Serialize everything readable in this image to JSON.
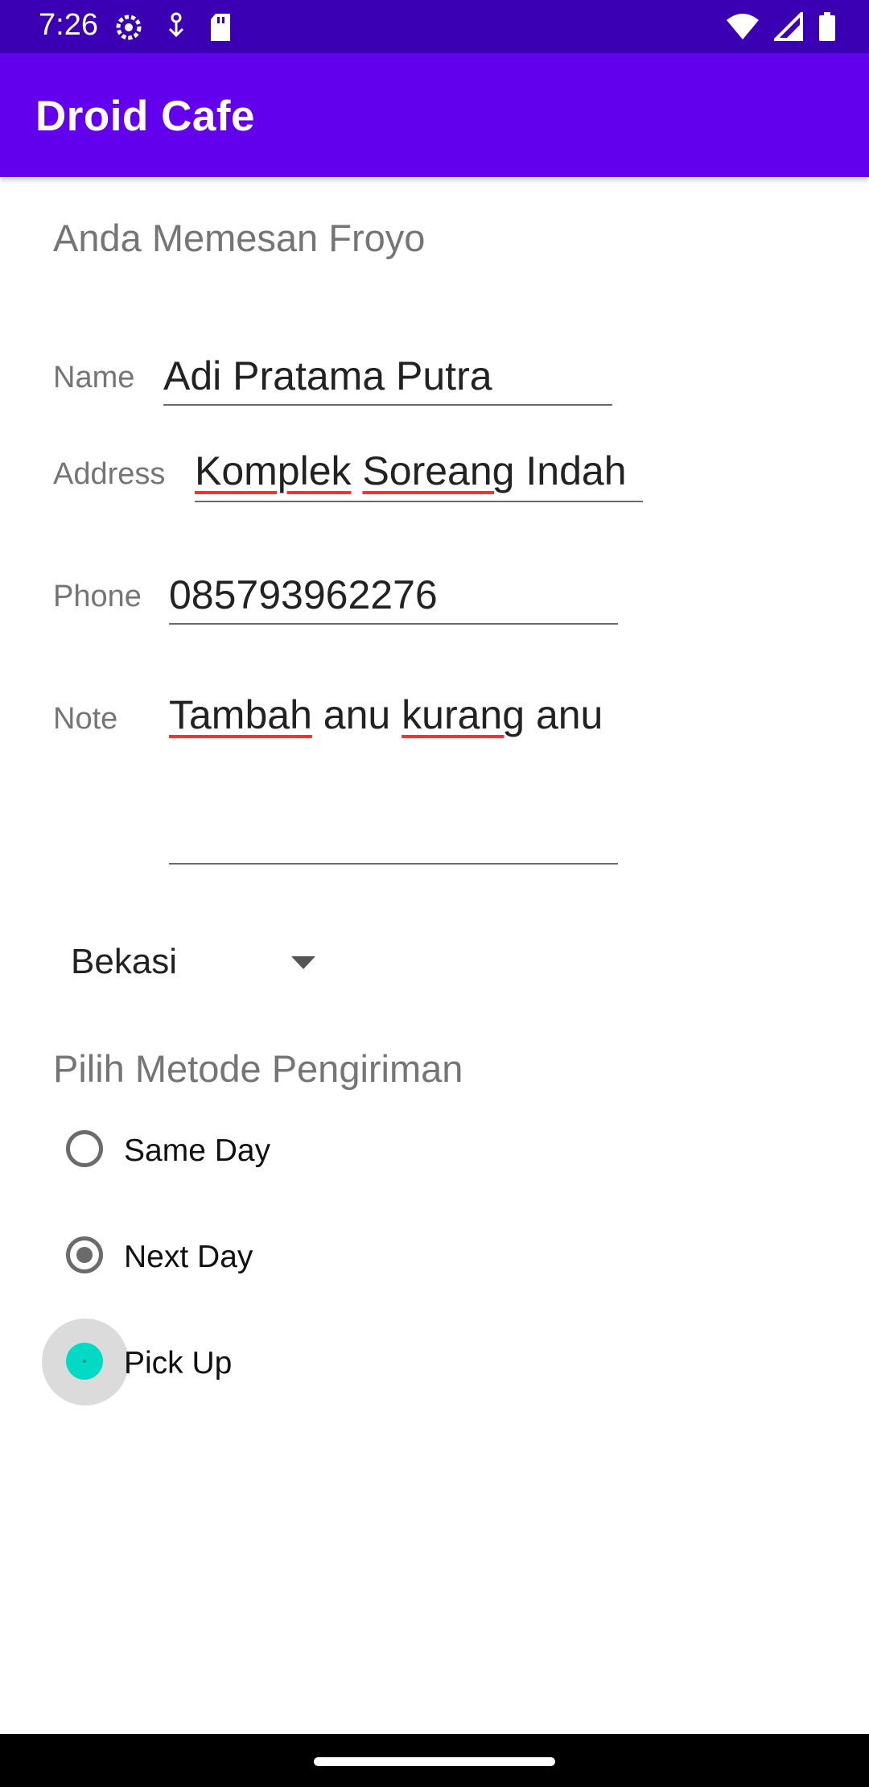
{
  "status_bar": {
    "time": "7:26",
    "left_icons": [
      "settings-icon",
      "usb-debug-icon",
      "sd-card-icon"
    ],
    "right_icons": [
      "wifi-icon",
      "signal-icon",
      "battery-icon"
    ]
  },
  "app_bar": {
    "title": "Droid Cafe",
    "color": "#6200ee"
  },
  "order": {
    "title": "Anda Memesan Froyo"
  },
  "form": {
    "name": {
      "label": "Name",
      "value": "Adi Pratama Putra"
    },
    "address": {
      "label": "Address",
      "value_words": [
        "Komplek",
        "Soreang",
        "Indah"
      ]
    },
    "phone": {
      "label": "Phone",
      "value": "085793962276"
    },
    "note": {
      "label": "Note",
      "value_words": [
        "Tambah",
        "anu",
        "kurang",
        "anu"
      ]
    }
  },
  "city_spinner": {
    "selected": "Bekasi"
  },
  "delivery": {
    "title": "Pilih Metode Pengiriman",
    "options": [
      {
        "label": "Same Day",
        "state": "unchecked"
      },
      {
        "label": "Next Day",
        "state": "checked"
      },
      {
        "label": "Pick Up",
        "state": "pressed"
      }
    ],
    "accent": "#03dac5"
  }
}
